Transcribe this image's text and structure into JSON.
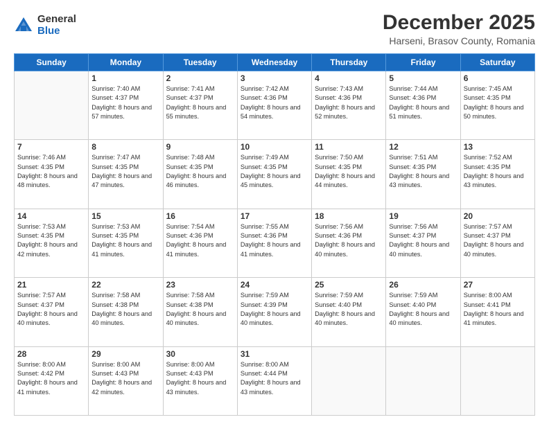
{
  "header": {
    "logo": {
      "general": "General",
      "blue": "Blue"
    },
    "month": "December 2025",
    "location": "Harseni, Brasov County, Romania"
  },
  "weekdays": [
    "Sunday",
    "Monday",
    "Tuesday",
    "Wednesday",
    "Thursday",
    "Friday",
    "Saturday"
  ],
  "weeks": [
    [
      {
        "day": "",
        "sunrise": "",
        "sunset": "",
        "daylight": ""
      },
      {
        "day": "1",
        "sunrise": "Sunrise: 7:40 AM",
        "sunset": "Sunset: 4:37 PM",
        "daylight": "Daylight: 8 hours and 57 minutes."
      },
      {
        "day": "2",
        "sunrise": "Sunrise: 7:41 AM",
        "sunset": "Sunset: 4:37 PM",
        "daylight": "Daylight: 8 hours and 55 minutes."
      },
      {
        "day": "3",
        "sunrise": "Sunrise: 7:42 AM",
        "sunset": "Sunset: 4:36 PM",
        "daylight": "Daylight: 8 hours and 54 minutes."
      },
      {
        "day": "4",
        "sunrise": "Sunrise: 7:43 AM",
        "sunset": "Sunset: 4:36 PM",
        "daylight": "Daylight: 8 hours and 52 minutes."
      },
      {
        "day": "5",
        "sunrise": "Sunrise: 7:44 AM",
        "sunset": "Sunset: 4:36 PM",
        "daylight": "Daylight: 8 hours and 51 minutes."
      },
      {
        "day": "6",
        "sunrise": "Sunrise: 7:45 AM",
        "sunset": "Sunset: 4:35 PM",
        "daylight": "Daylight: 8 hours and 50 minutes."
      }
    ],
    [
      {
        "day": "7",
        "sunrise": "Sunrise: 7:46 AM",
        "sunset": "Sunset: 4:35 PM",
        "daylight": "Daylight: 8 hours and 48 minutes."
      },
      {
        "day": "8",
        "sunrise": "Sunrise: 7:47 AM",
        "sunset": "Sunset: 4:35 PM",
        "daylight": "Daylight: 8 hours and 47 minutes."
      },
      {
        "day": "9",
        "sunrise": "Sunrise: 7:48 AM",
        "sunset": "Sunset: 4:35 PM",
        "daylight": "Daylight: 8 hours and 46 minutes."
      },
      {
        "day": "10",
        "sunrise": "Sunrise: 7:49 AM",
        "sunset": "Sunset: 4:35 PM",
        "daylight": "Daylight: 8 hours and 45 minutes."
      },
      {
        "day": "11",
        "sunrise": "Sunrise: 7:50 AM",
        "sunset": "Sunset: 4:35 PM",
        "daylight": "Daylight: 8 hours and 44 minutes."
      },
      {
        "day": "12",
        "sunrise": "Sunrise: 7:51 AM",
        "sunset": "Sunset: 4:35 PM",
        "daylight": "Daylight: 8 hours and 43 minutes."
      },
      {
        "day": "13",
        "sunrise": "Sunrise: 7:52 AM",
        "sunset": "Sunset: 4:35 PM",
        "daylight": "Daylight: 8 hours and 43 minutes."
      }
    ],
    [
      {
        "day": "14",
        "sunrise": "Sunrise: 7:53 AM",
        "sunset": "Sunset: 4:35 PM",
        "daylight": "Daylight: 8 hours and 42 minutes."
      },
      {
        "day": "15",
        "sunrise": "Sunrise: 7:53 AM",
        "sunset": "Sunset: 4:35 PM",
        "daylight": "Daylight: 8 hours and 41 minutes."
      },
      {
        "day": "16",
        "sunrise": "Sunrise: 7:54 AM",
        "sunset": "Sunset: 4:36 PM",
        "daylight": "Daylight: 8 hours and 41 minutes."
      },
      {
        "day": "17",
        "sunrise": "Sunrise: 7:55 AM",
        "sunset": "Sunset: 4:36 PM",
        "daylight": "Daylight: 8 hours and 41 minutes."
      },
      {
        "day": "18",
        "sunrise": "Sunrise: 7:56 AM",
        "sunset": "Sunset: 4:36 PM",
        "daylight": "Daylight: 8 hours and 40 minutes."
      },
      {
        "day": "19",
        "sunrise": "Sunrise: 7:56 AM",
        "sunset": "Sunset: 4:37 PM",
        "daylight": "Daylight: 8 hours and 40 minutes."
      },
      {
        "day": "20",
        "sunrise": "Sunrise: 7:57 AM",
        "sunset": "Sunset: 4:37 PM",
        "daylight": "Daylight: 8 hours and 40 minutes."
      }
    ],
    [
      {
        "day": "21",
        "sunrise": "Sunrise: 7:57 AM",
        "sunset": "Sunset: 4:37 PM",
        "daylight": "Daylight: 8 hours and 40 minutes."
      },
      {
        "day": "22",
        "sunrise": "Sunrise: 7:58 AM",
        "sunset": "Sunset: 4:38 PM",
        "daylight": "Daylight: 8 hours and 40 minutes."
      },
      {
        "day": "23",
        "sunrise": "Sunrise: 7:58 AM",
        "sunset": "Sunset: 4:38 PM",
        "daylight": "Daylight: 8 hours and 40 minutes."
      },
      {
        "day": "24",
        "sunrise": "Sunrise: 7:59 AM",
        "sunset": "Sunset: 4:39 PM",
        "daylight": "Daylight: 8 hours and 40 minutes."
      },
      {
        "day": "25",
        "sunrise": "Sunrise: 7:59 AM",
        "sunset": "Sunset: 4:40 PM",
        "daylight": "Daylight: 8 hours and 40 minutes."
      },
      {
        "day": "26",
        "sunrise": "Sunrise: 7:59 AM",
        "sunset": "Sunset: 4:40 PM",
        "daylight": "Daylight: 8 hours and 40 minutes."
      },
      {
        "day": "27",
        "sunrise": "Sunrise: 8:00 AM",
        "sunset": "Sunset: 4:41 PM",
        "daylight": "Daylight: 8 hours and 41 minutes."
      }
    ],
    [
      {
        "day": "28",
        "sunrise": "Sunrise: 8:00 AM",
        "sunset": "Sunset: 4:42 PM",
        "daylight": "Daylight: 8 hours and 41 minutes."
      },
      {
        "day": "29",
        "sunrise": "Sunrise: 8:00 AM",
        "sunset": "Sunset: 4:43 PM",
        "daylight": "Daylight: 8 hours and 42 minutes."
      },
      {
        "day": "30",
        "sunrise": "Sunrise: 8:00 AM",
        "sunset": "Sunset: 4:43 PM",
        "daylight": "Daylight: 8 hours and 43 minutes."
      },
      {
        "day": "31",
        "sunrise": "Sunrise: 8:00 AM",
        "sunset": "Sunset: 4:44 PM",
        "daylight": "Daylight: 8 hours and 43 minutes."
      },
      {
        "day": "",
        "sunrise": "",
        "sunset": "",
        "daylight": ""
      },
      {
        "day": "",
        "sunrise": "",
        "sunset": "",
        "daylight": ""
      },
      {
        "day": "",
        "sunrise": "",
        "sunset": "",
        "daylight": ""
      }
    ]
  ]
}
